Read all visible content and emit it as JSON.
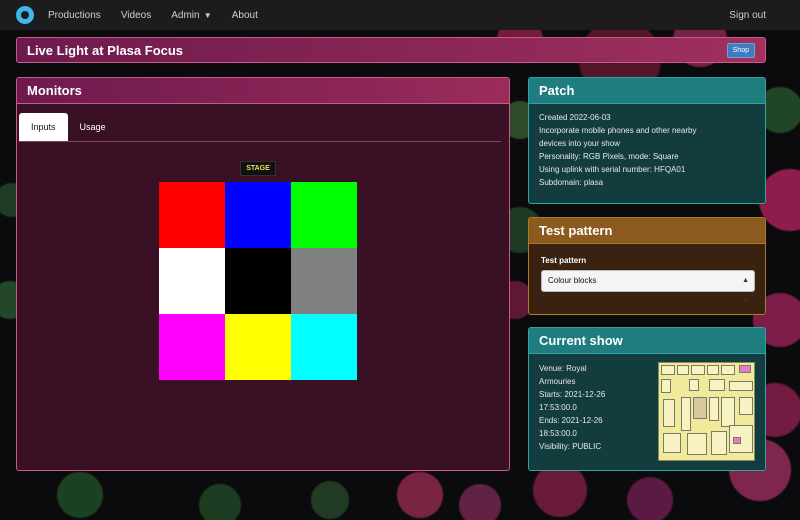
{
  "navbar": {
    "items": [
      "Productions",
      "Videos",
      "Admin",
      "About"
    ],
    "signout": "Sign out"
  },
  "title_bar": {
    "title": "Live Light at Plasa Focus",
    "shop": "Shop"
  },
  "monitors": {
    "title": "Monitors",
    "tabs": [
      "Inputs",
      "Usage"
    ],
    "stage": "STAGE",
    "colours": [
      "#ff0000",
      "#0000ff",
      "#00ff00",
      "#ffffff",
      "#000000",
      "#808080",
      "#ff00ff",
      "#ffff00",
      "#00ffff"
    ]
  },
  "patch": {
    "title": "Patch",
    "lines": [
      "Created 2022-06-03",
      "Incorporate mobile phones and other nearby",
      "devices into your show",
      "Personality: RGB Pixels, mode: Square",
      "Using uplink with serial number: HFQA01",
      "Subdomain: plasa"
    ]
  },
  "test_pattern": {
    "title": "Test pattern",
    "label": "Test pattern",
    "selected": "Colour blocks"
  },
  "current_show": {
    "title": "Current show",
    "lines": [
      "Venue: Royal",
      "Armouries",
      "Starts: 2021-12-26",
      "17:53:00.0",
      "Ends: 2021-12-26",
      "18:53:00.0",
      "Visibility: PUBLIC"
    ]
  }
}
